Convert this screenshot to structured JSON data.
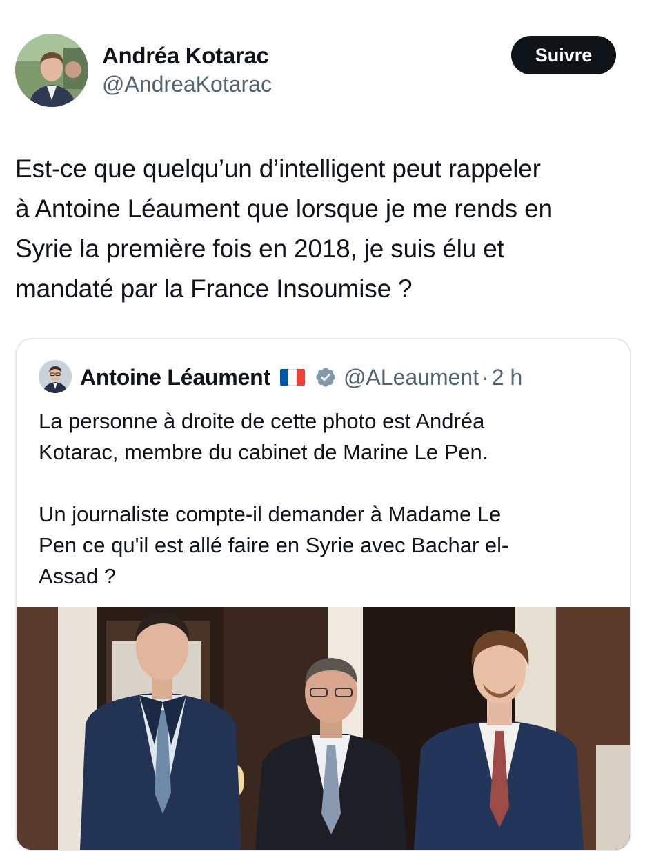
{
  "author": {
    "name": "Andréa Kotarac",
    "handle": "@AndreaKotarac",
    "avatar_icon": "profile-photo"
  },
  "follow_button": {
    "label": "Suivre"
  },
  "tweet": {
    "lines": [
      "Est-ce que quelqu’un d’intelligent peut rappeler",
      "à Antoine Léaument que lorsque je me rends en",
      "Syrie la première fois en 2018, je suis élu et",
      "mandaté par la France Insoumise ?"
    ]
  },
  "quoted_tweet": {
    "name": "Antoine Léaument",
    "flag_icon": "france-flag-icon",
    "verified_icon": "verified-badge-icon",
    "handle": "@ALeaument",
    "separator": "·",
    "time": "2 h",
    "paragraph1": [
      "La personne à droite de cette photo est Andréa",
      "Kotarac, membre du cabinet de Marine Le Pen."
    ],
    "paragraph2": [
      "Un journaliste compte-il demander à Madame Le",
      "Pen ce qu'il est allé faire en Syrie avec Bachar el-",
      "Assad ?"
    ],
    "media_icon": "photo-three-men-in-suits"
  },
  "colors": {
    "text": "#0f1419",
    "secondary": "#536471",
    "button_bg": "#0f1419",
    "border": "#e4e8eb",
    "flag_blue": "#0055a4",
    "flag_red": "#ef4135",
    "verified_gray": "#829aab"
  }
}
